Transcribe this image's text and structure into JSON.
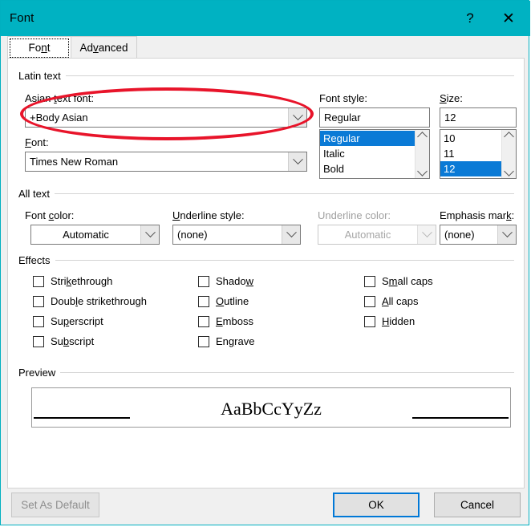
{
  "window": {
    "title": "Font",
    "help_icon": "?",
    "close_icon": "✕",
    "accent_color": "#00b2c2"
  },
  "tabs": [
    {
      "label": "Font",
      "selected": true
    },
    {
      "label": "Advanced",
      "selected": false
    }
  ],
  "groups": {
    "latin_text": "Latin text",
    "all_text": "All text",
    "effects": "Effects",
    "preview": "Preview"
  },
  "latin_text": {
    "asian_font_label": "Asian text font:",
    "asian_font_value": "+Body Asian",
    "font_label": "Font:",
    "font_value": "Times New Roman",
    "font_style_label": "Font style:",
    "font_style_value": "Regular",
    "font_style_options": [
      "Regular",
      "Italic",
      "Bold"
    ],
    "font_style_selected": "Regular",
    "size_label": "Size:",
    "size_value": "12",
    "size_options": [
      "10",
      "11",
      "12"
    ],
    "size_selected": "12"
  },
  "all_text": {
    "font_color_label": "Font color:",
    "font_color_value": "Automatic",
    "underline_style_label": "Underline style:",
    "underline_style_value": "(none)",
    "underline_color_label": "Underline color:",
    "underline_color_value": "Automatic",
    "underline_color_disabled": true,
    "emphasis_mark_label": "Emphasis mark:",
    "emphasis_mark_value": "(none)"
  },
  "effects": {
    "column1": [
      {
        "label": "Strikethrough",
        "checked": false
      },
      {
        "label": "Double strikethrough",
        "checked": false
      },
      {
        "label": "Superscript",
        "checked": false
      },
      {
        "label": "Subscript",
        "checked": false
      }
    ],
    "column2": [
      {
        "label": "Shadow",
        "checked": false
      },
      {
        "label": "Outline",
        "checked": false
      },
      {
        "label": "Emboss",
        "checked": false
      },
      {
        "label": "Engrave",
        "checked": false
      }
    ],
    "column3": [
      {
        "label": "Small caps",
        "checked": false
      },
      {
        "label": "All caps",
        "checked": false
      },
      {
        "label": "Hidden",
        "checked": false
      }
    ]
  },
  "preview": {
    "sample_text": "AaBbCcYyZz"
  },
  "footer": {
    "set_as_default": "Set As Default",
    "set_as_default_disabled": true,
    "ok": "OK",
    "cancel": "Cancel",
    "default_button": "OK"
  },
  "annotation": {
    "shape": "ellipse",
    "color": "#e8142a",
    "target": "Asian text font combobox"
  }
}
